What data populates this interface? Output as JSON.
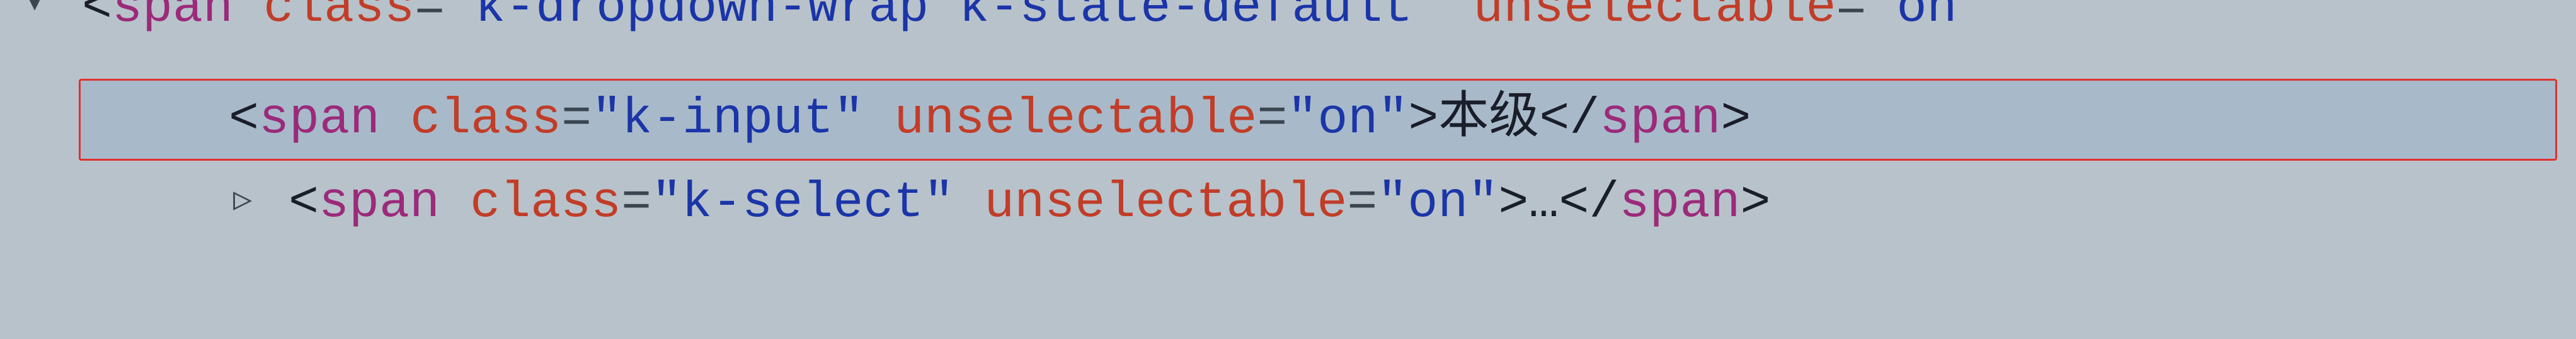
{
  "line1": {
    "tag": "span",
    "attr1_name": "class",
    "attr1_val": "\"k-dropdown-wrap k-state-default\"",
    "attr2_name": "unselectable",
    "attr2_val_partial": "\"on"
  },
  "line2": {
    "tag_open": "span",
    "attr1_name": "class",
    "attr1_val": "\"k-input\"",
    "attr2_name": "unselectable",
    "attr2_val": "\"on\"",
    "text": "本级",
    "tag_close": "span"
  },
  "line3": {
    "tag_open": "span",
    "attr1_name": "class",
    "attr1_val": "\"k-select\"",
    "attr2_name": "unselectable",
    "attr2_val": "\"on\"",
    "ellipsis": "…",
    "tag_close": "span"
  },
  "arrows": {
    "down": "▾",
    "right": "▷"
  }
}
